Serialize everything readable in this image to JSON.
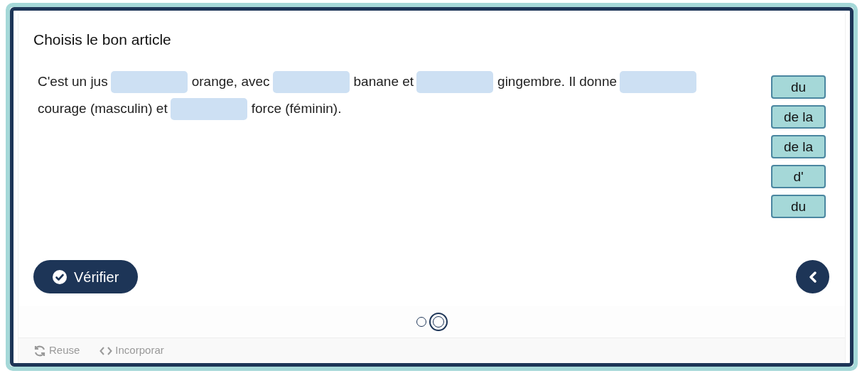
{
  "title": "Choisis le bon article",
  "sentence": [
    {
      "kind": "text",
      "text": "C'est un jus"
    },
    {
      "kind": "blank"
    },
    {
      "kind": "text",
      "text": "orange, avec"
    },
    {
      "kind": "blank"
    },
    {
      "kind": "text",
      "text": "banane et"
    },
    {
      "kind": "blank"
    },
    {
      "kind": "text",
      "text": "gingembre. Il donne"
    },
    {
      "kind": "blank"
    },
    {
      "kind": "text",
      "text": "courage (masculin) et"
    },
    {
      "kind": "blank"
    },
    {
      "kind": "text",
      "text": "force (féminin)."
    }
  ],
  "word_bank": [
    "du",
    "de la",
    "de la",
    "d'",
    "du"
  ],
  "check_button": "Vérifier",
  "pager": [
    {
      "selected": false
    },
    {
      "selected": true
    }
  ],
  "footer": [
    {
      "kind": "reuse",
      "label": "Reuse"
    },
    {
      "kind": "embed",
      "label": "Incorporar"
    }
  ]
}
